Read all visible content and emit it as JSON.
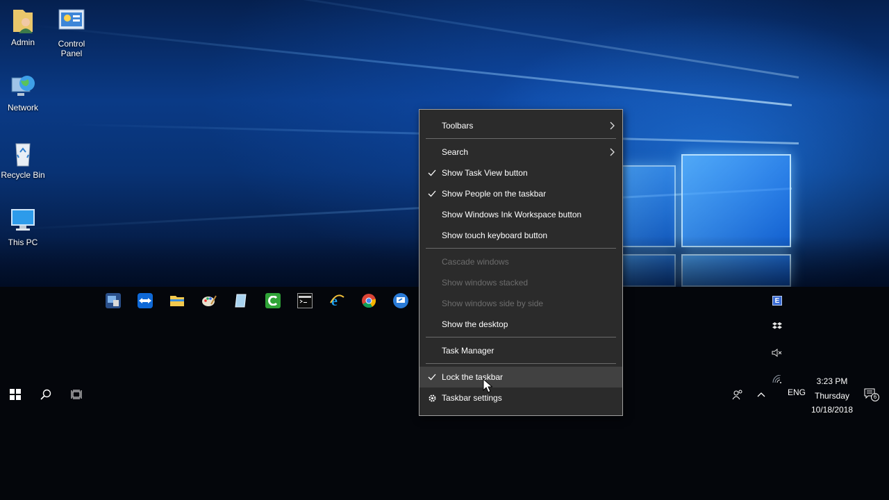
{
  "desktop": {
    "icons": [
      {
        "label": "Admin"
      },
      {
        "label": "Control\nPanel"
      },
      {
        "label": "Network"
      },
      {
        "label": "Recycle Bin"
      },
      {
        "label": "This PC"
      }
    ]
  },
  "context_menu": {
    "items": [
      {
        "label": "Toolbars",
        "submenu": true
      },
      {
        "label": "Search",
        "submenu": true
      },
      {
        "label": "Show Task View button",
        "checked": true
      },
      {
        "label": "Show People on the taskbar",
        "checked": true
      },
      {
        "label": "Show Windows Ink Workspace button"
      },
      {
        "label": "Show touch keyboard button"
      },
      {
        "label": "Cascade windows",
        "disabled": true
      },
      {
        "label": "Show windows stacked",
        "disabled": true
      },
      {
        "label": "Show windows side by side",
        "disabled": true
      },
      {
        "label": "Show the desktop"
      },
      {
        "label": "Task Manager"
      },
      {
        "label": "Lock the taskbar",
        "checked": true,
        "hovered": true
      },
      {
        "label": "Taskbar settings",
        "icon": "gear-icon"
      }
    ]
  },
  "tray": {
    "language": "ENG",
    "time": "3:23 PM",
    "day": "Thursday",
    "date": "10/18/2018",
    "notification_count": "6"
  },
  "colors": {
    "menu_background": "#2b2b2b",
    "menu_hover": "#414141",
    "menu_disabled_text": "#6d6d6d",
    "taskbar_background": "#04060b"
  }
}
